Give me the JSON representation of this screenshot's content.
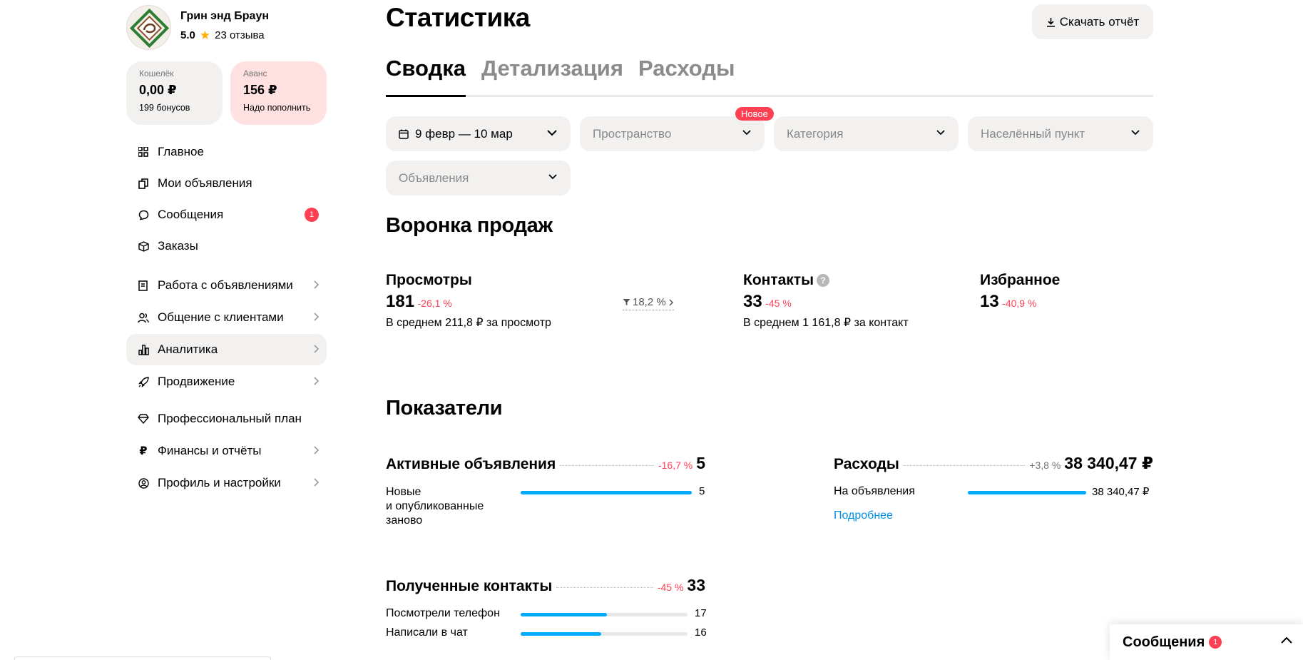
{
  "shop": {
    "name": "Грин энд Браун",
    "score": "5.0",
    "reviews": "23 отзыва"
  },
  "wallet": {
    "caption": "Кошелёк",
    "amount": "0,00 ₽",
    "sub": "199 бонусов"
  },
  "avans": {
    "caption": "Аванс",
    "amount": "156 ₽",
    "sub": "Надо пополнить"
  },
  "nav": {
    "items": [
      {
        "label": "Главное",
        "icon": "grid-icon"
      },
      {
        "label": "Мои объявления",
        "icon": "copy-icon"
      },
      {
        "label": "Сообщения",
        "icon": "chat-icon",
        "badge": "1"
      },
      {
        "label": "Заказы",
        "icon": "box-icon"
      },
      {
        "label": "Работа с объявлениями",
        "icon": "edit-icon"
      },
      {
        "label": "Общение с клиентами",
        "icon": "users-icon"
      },
      {
        "label": "Аналитика",
        "icon": "chart-icon"
      },
      {
        "label": "Продвижение",
        "icon": "rocket-icon"
      },
      {
        "label": "Профессиональный план",
        "icon": "diamond-icon"
      },
      {
        "label": "Финансы и отчёты",
        "icon": "ruble-icon"
      },
      {
        "label": "Профиль и настройки",
        "icon": "profile-icon"
      }
    ]
  },
  "header": {
    "title": "Статистика",
    "download_label": "Скачать отчёт"
  },
  "tabs": [
    "Сводка",
    "Детализация",
    "Расходы"
  ],
  "filters": {
    "date": "9 февр — 10 мар",
    "space": "Пространство",
    "new_badge": "Новое",
    "category": "Категория",
    "locality": "Населённый пункт",
    "ads": "Объявления"
  },
  "funnel": {
    "title": "Воронка продаж",
    "views": {
      "label": "Просмотры",
      "value": "181",
      "change": "-26,1 %",
      "avg": "В среднем 211,8 ₽ за просмотр",
      "conversion": "18,2 %"
    },
    "contacts": {
      "label": "Контакты",
      "help": "?",
      "value": "33",
      "change": "-45 %",
      "avg": "В среднем 1 161,8 ₽ за контакт"
    },
    "favorites": {
      "label": "Избранное",
      "value": "13",
      "change": "-40,9 %"
    }
  },
  "indicators": {
    "title": "Показатели",
    "active": {
      "label": "Активные объявления",
      "change": "-16,7 %",
      "value": "5",
      "rows": [
        {
          "label": "Новые\nи опубликованные\nзаново",
          "value": "5",
          "fill": 1.0
        }
      ]
    },
    "expenses": {
      "label": "Расходы",
      "change": "+3,8 %",
      "value": "38 340,47 ₽",
      "rows": [
        {
          "label": "На объявления",
          "value": "38 340,47 ₽",
          "fill": 1.0
        }
      ],
      "more_link": "Подробнее"
    },
    "received": {
      "label": "Полученные контакты",
      "change": "-45 %",
      "value": "33",
      "rows": [
        {
          "label": "Посмотрели телефон",
          "value": "17",
          "fill": 0.515
        },
        {
          "label": "Написали в чат",
          "value": "16",
          "fill": 0.485
        }
      ]
    }
  },
  "messages_panel": {
    "label": "Сообщения",
    "badge": "1"
  },
  "colors": {
    "accent_red": "#ff4053",
    "bar_blue": "#00aaff",
    "link_blue": "#0091ea",
    "surface": "#f2f1f0"
  }
}
